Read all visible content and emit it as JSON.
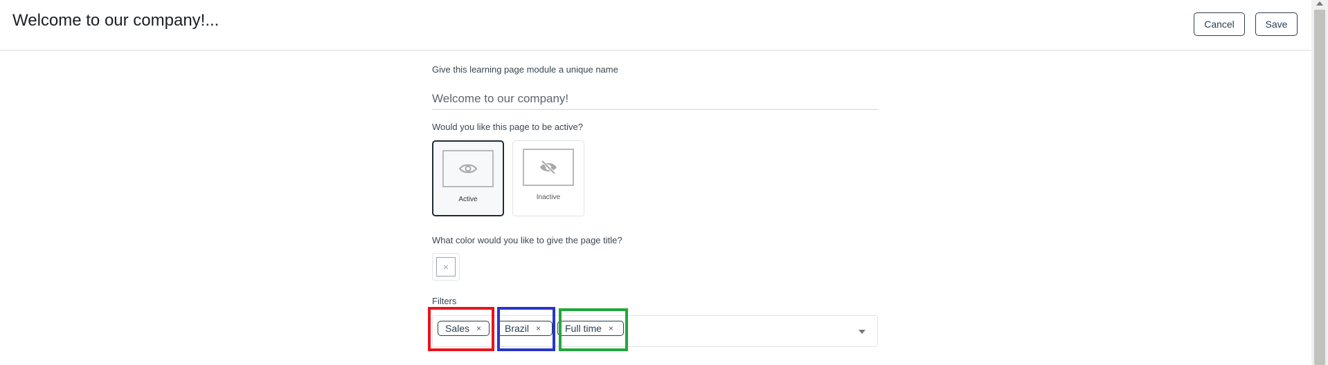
{
  "header": {
    "title": "Welcome to our company!...",
    "cancel_label": "Cancel",
    "save_label": "Save"
  },
  "form": {
    "name_label": "Give this learning page module a unique name",
    "name_value": "Welcome to our company!",
    "active_label": "Would you like this page to be active?",
    "options": [
      {
        "label": "Active",
        "icon": "eye-icon",
        "selected": true
      },
      {
        "label": "Inactive",
        "icon": "eye-off-icon",
        "selected": false
      }
    ],
    "color_label": "What color would you like to give the page title?",
    "filters_label": "Filters",
    "filters": [
      {
        "label": "Sales",
        "highlight": "#e8141c"
      },
      {
        "label": "Brazil",
        "highlight": "#2a35c8"
      },
      {
        "label": "Full time",
        "highlight": "#1fa83a"
      }
    ]
  },
  "colors": {
    "accent": "#2b3e50",
    "highlight_red": "#e8141c",
    "highlight_blue": "#2a35c8",
    "highlight_green": "#1fa83a"
  }
}
